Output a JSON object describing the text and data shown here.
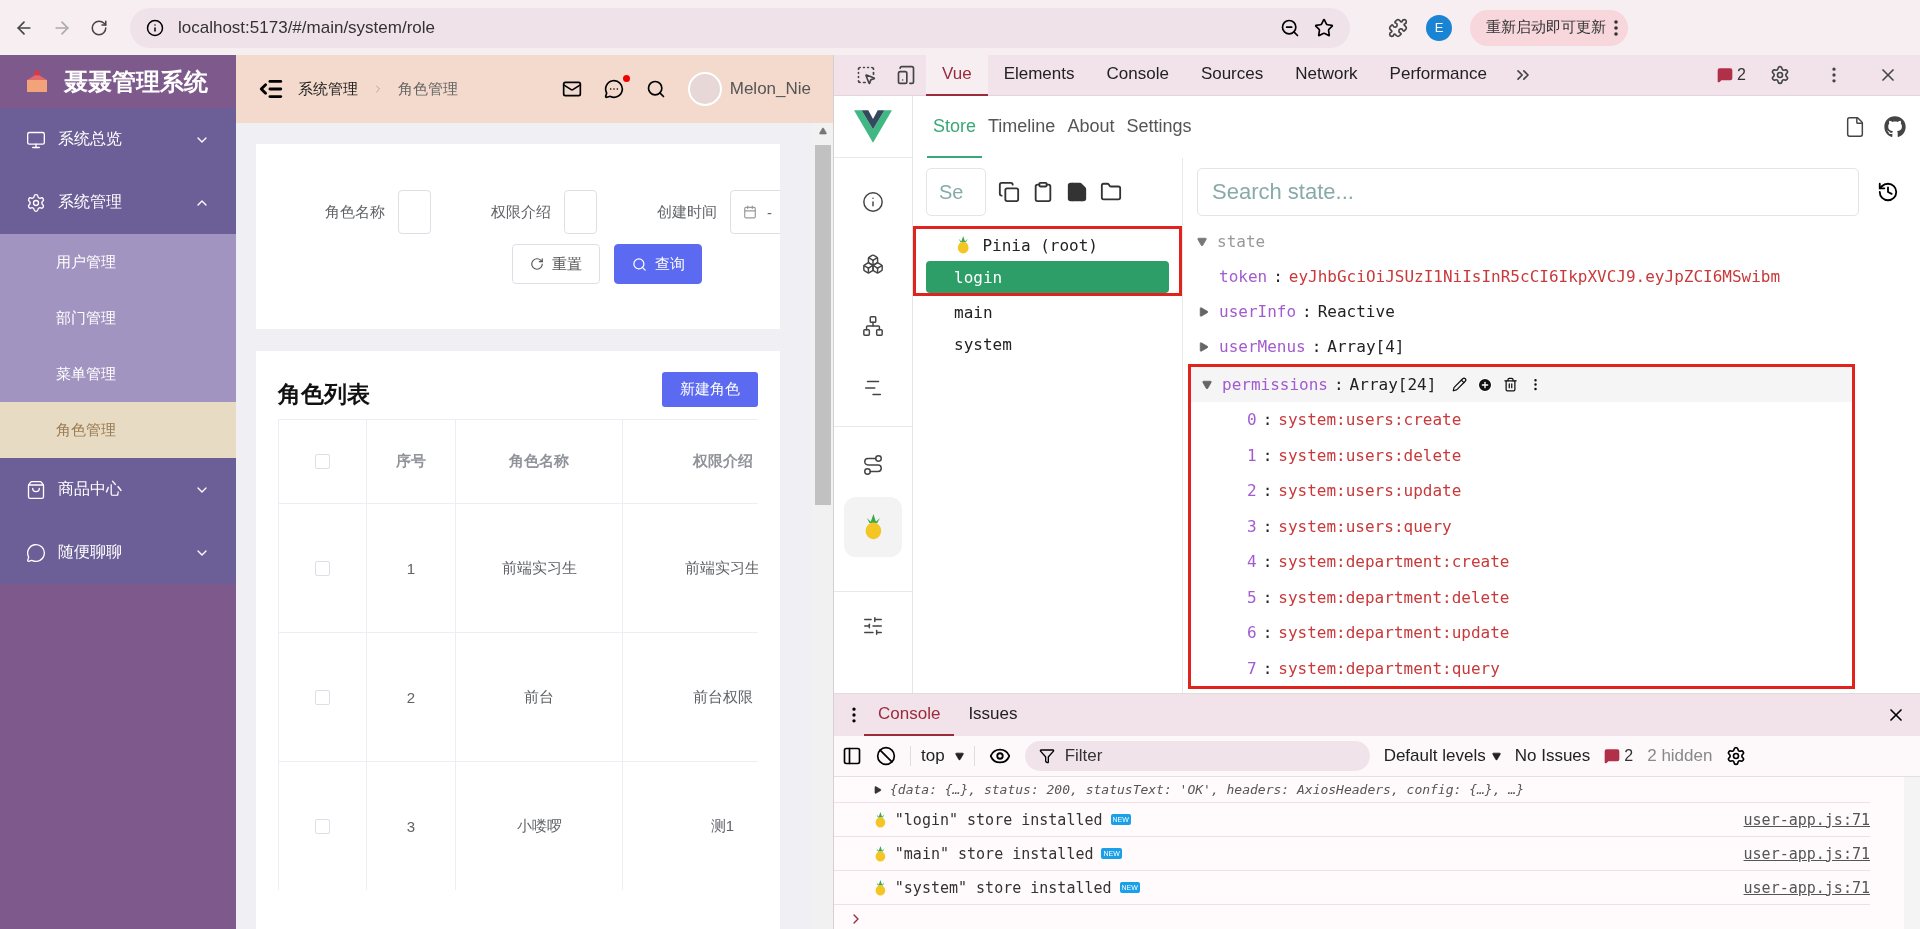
{
  "browser": {
    "url": "localhost:5173/#/main/system/role",
    "profile_initial": "E",
    "update_label": "重新启动即可更新"
  },
  "app": {
    "title": "聂聂管理系统",
    "menu": [
      {
        "label": "系统总览",
        "expanded": false
      },
      {
        "label": "系统管理",
        "expanded": true,
        "children": [
          {
            "label": "用户管理",
            "selected": false
          },
          {
            "label": "部门管理",
            "selected": false
          },
          {
            "label": "菜单管理",
            "selected": false
          },
          {
            "label": "角色管理",
            "selected": true
          }
        ]
      },
      {
        "label": "商品中心",
        "expanded": false
      },
      {
        "label": "随便聊聊",
        "expanded": false
      }
    ],
    "breadcrumb": [
      "系统管理",
      "角色管理"
    ],
    "messages_unread": true,
    "user_name": "Melon_Nie",
    "search_form": {
      "fields": [
        {
          "label": "角色名称",
          "kind": "text"
        },
        {
          "label": "权限介绍",
          "kind": "text"
        },
        {
          "label": "创建时间",
          "kind": "date",
          "value": "-"
        }
      ],
      "buttons": [
        {
          "label": "重置",
          "kind": "reset"
        },
        {
          "label": "查询",
          "kind": "primary"
        }
      ]
    },
    "table": {
      "title": "角色列表",
      "create_button": "新建角色",
      "header_checked": false,
      "columns": [
        "序号",
        "角色名称",
        "权限介绍"
      ],
      "rows": [
        {
          "checked": false,
          "cells": [
            "1",
            "前端实习生",
            "前端实习生"
          ]
        },
        {
          "checked": false,
          "cells": [
            "2",
            "前台",
            "前台权限"
          ]
        },
        {
          "checked": false,
          "cells": [
            "3",
            "小喽啰",
            "测1"
          ]
        }
      ]
    }
  },
  "devtools": {
    "tabs": [
      {
        "label": "Vue",
        "selected": true
      },
      {
        "label": "Elements",
        "selected": false
      },
      {
        "label": "Console",
        "selected": false
      },
      {
        "label": "Sources",
        "selected": false
      },
      {
        "label": "Network",
        "selected": false
      },
      {
        "label": "Performance",
        "selected": false
      }
    ],
    "issues_count": "2",
    "vue": {
      "tabs": [
        {
          "label": "Store",
          "selected": true
        },
        {
          "label": "Timeline",
          "selected": false
        },
        {
          "label": "About",
          "selected": false
        },
        {
          "label": "Settings",
          "selected": false
        }
      ],
      "rail": [
        {
          "selected": false
        },
        {
          "selected": false
        },
        {
          "selected": false
        },
        {
          "selected": false
        },
        {
          "selected": false
        },
        {
          "selected": true
        }
      ],
      "store_search_placeholder": "Se",
      "root": {
        "label": "Pinia (root)",
        "framed": true
      },
      "stores": [
        {
          "label": "login",
          "selected": true,
          "framed": true
        },
        {
          "label": "main",
          "selected": false,
          "framed": false
        },
        {
          "label": "system",
          "selected": false,
          "framed": false
        }
      ],
      "state_search_placeholder": "Search state...",
      "state_label": "state",
      "entries": [
        {
          "key": "token",
          "separator": ":",
          "kind": "string",
          "value": "eyJhbGciOiJSUzI1NiIsInR5cCI6IkpXVCJ9.eyJpZCI6MSwibm",
          "framed": false
        },
        {
          "key": "userInfo",
          "separator": ":",
          "kind": "object",
          "expanded": false,
          "value": "Reactive",
          "framed": false
        },
        {
          "key": "userMenus",
          "separator": ":",
          "kind": "object",
          "expanded": false,
          "value": "Array[4]",
          "framed": false
        },
        {
          "key": "permissions",
          "separator": ":",
          "kind": "object",
          "expanded": true,
          "value": "Array[24]",
          "framed": true,
          "items": [
            {
              "index": "0",
              "separator": ":",
              "value": "system:users:create"
            },
            {
              "index": "1",
              "separator": ":",
              "value": "system:users:delete"
            },
            {
              "index": "2",
              "separator": ":",
              "value": "system:users:update"
            },
            {
              "index": "3",
              "separator": ":",
              "value": "system:users:query"
            },
            {
              "index": "4",
              "separator": ":",
              "value": "system:department:create"
            },
            {
              "index": "5",
              "separator": ":",
              "value": "system:department:delete"
            },
            {
              "index": "6",
              "separator": ":",
              "value": "system:department:update"
            },
            {
              "index": "7",
              "separator": ":",
              "value": "system:department:query"
            }
          ]
        }
      ]
    }
  },
  "console": {
    "tabs": [
      {
        "label": "Console",
        "selected": true
      },
      {
        "label": "Issues",
        "selected": false
      }
    ],
    "context": "top",
    "filter_placeholder": "Filter",
    "levels": "Default levels",
    "no_issues": "No Issues",
    "issues_count": "2",
    "hidden": "2 hidden",
    "logs": [
      {
        "kind": "object",
        "text": "{data: {…}, status: 200, statusText: 'OK', headers: AxiosHeaders, config: {…}, …}"
      },
      {
        "kind": "pinia",
        "text": "\"login\" store installed",
        "badge": "NEW",
        "source": "user-app.js:71"
      },
      {
        "kind": "pinia",
        "text": "\"main\" store installed",
        "badge": "NEW",
        "source": "user-app.js:71"
      },
      {
        "kind": "pinia",
        "text": "\"system\" store installed",
        "badge": "NEW",
        "source": "user-app.js:71"
      }
    ]
  }
}
